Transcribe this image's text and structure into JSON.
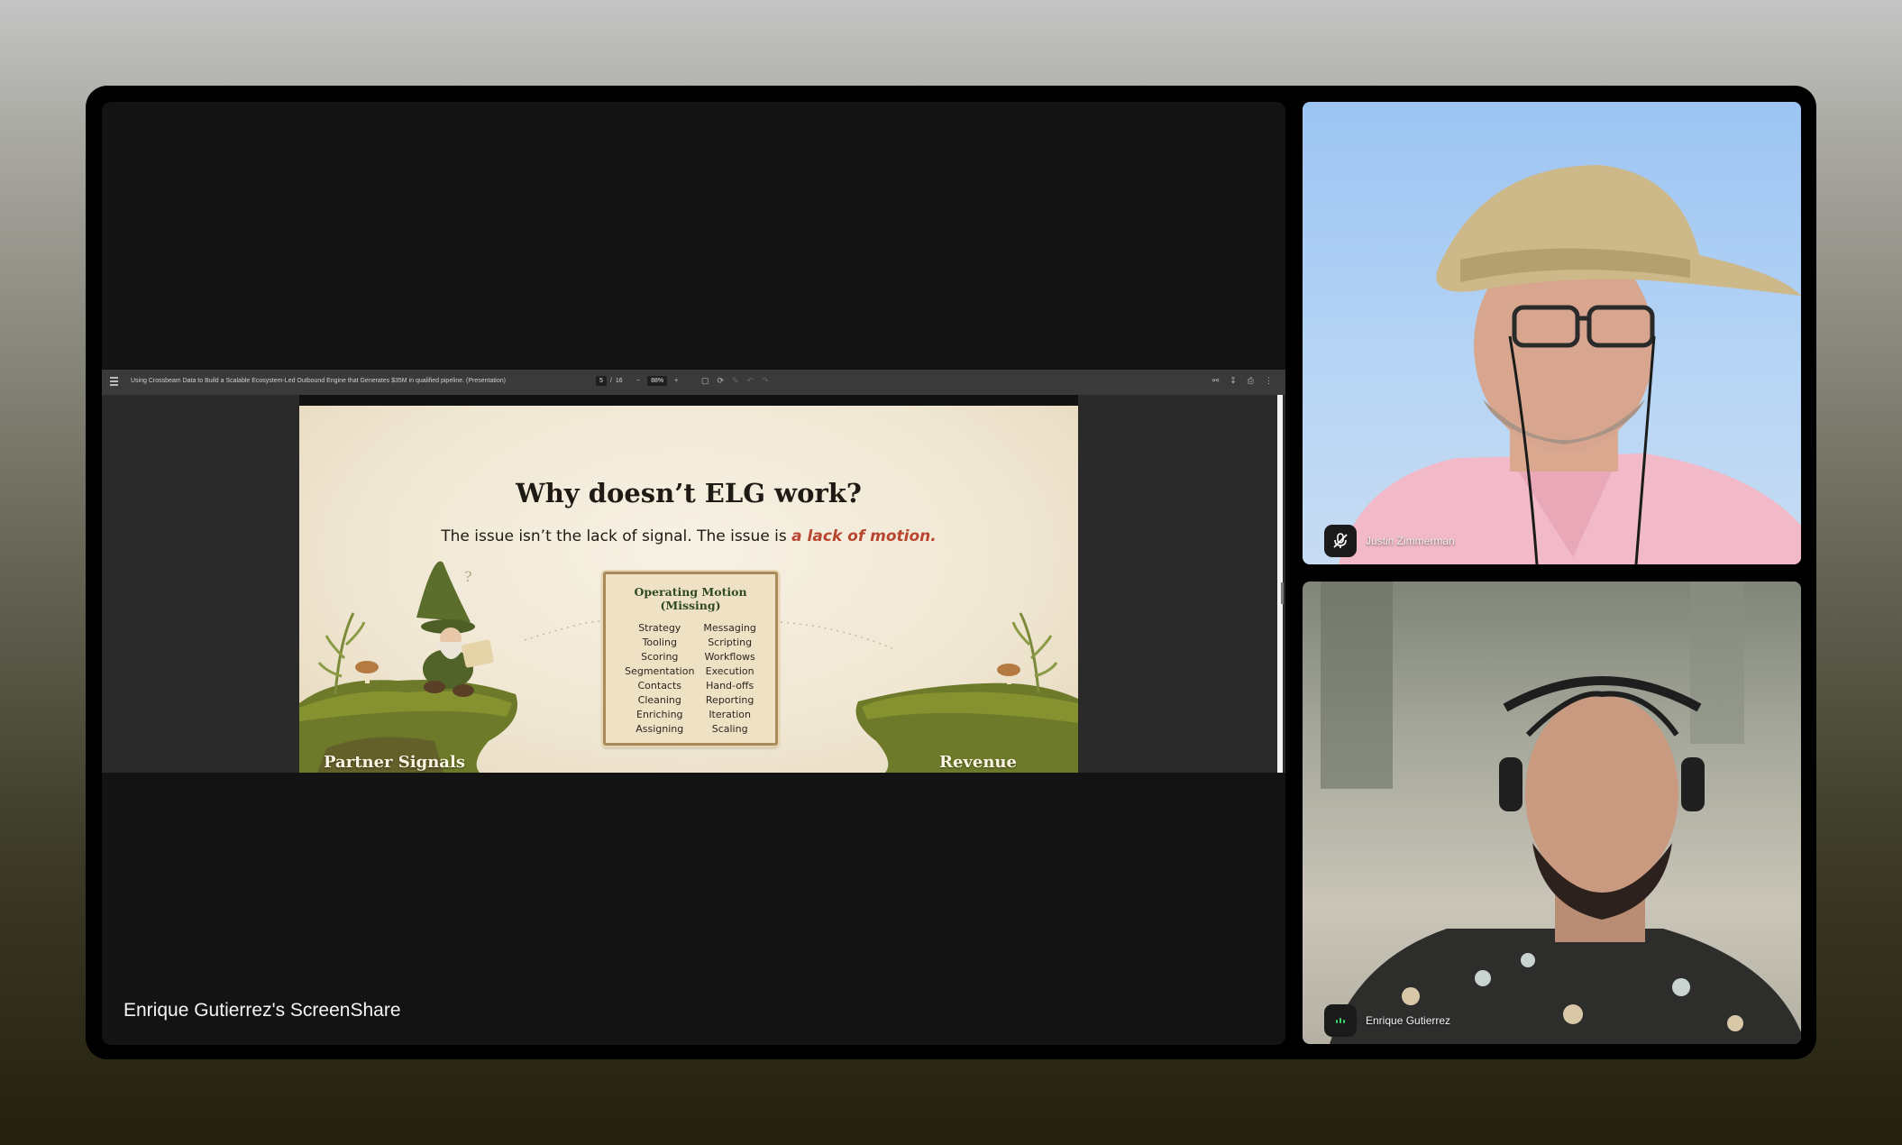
{
  "screenshare": {
    "label": "Enrique Gutierrez's ScreenShare",
    "viewer": {
      "document_title": "Using Crossbeam Data to Build a Scalable Ecosystem-Led Outbound Engine that Generates $35M in qualified pipeline. (Presentation)",
      "page_current": "5",
      "page_separator": "/",
      "page_total": "16",
      "zoom_minus": "−",
      "zoom": "88%",
      "zoom_plus": "+"
    },
    "slide": {
      "title": "Why doesn’t ELG work?",
      "subtitle_prefix": "The issue isn’t the lack of signal. The issue is ",
      "subtitle_emphasis": "a lack of motion.",
      "card_title": "Operating Motion (Missing)",
      "card_left": [
        "Strategy",
        "Tooling",
        "Scoring",
        "Segmentation",
        "Contacts",
        "Cleaning",
        "Enriching",
        "Assigning"
      ],
      "card_right": [
        "Messaging",
        "Scripting",
        "Workflows",
        "Execution",
        "Hand-offs",
        "Reporting",
        "Iteration",
        "Scaling"
      ],
      "left_label": "Partner Signals",
      "right_label": "Revenue",
      "question_mark": "?"
    }
  },
  "participants": [
    {
      "name": "Justin Zimmerman",
      "status_icon": "muted-microphone-icon"
    },
    {
      "name": "Enrique Gutierrez",
      "status_icon": "audio-level-icon"
    }
  ],
  "colors": {
    "emphasis": "#b8452f",
    "card_title": "#2f4a22",
    "frame": "#000000",
    "tile_bg": "#131313"
  }
}
